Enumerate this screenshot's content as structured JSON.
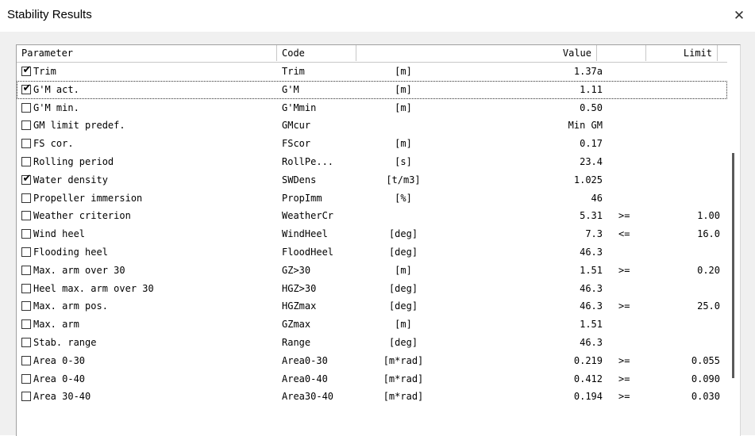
{
  "window": {
    "title": "Stability Results",
    "close_glyph": "✕"
  },
  "table": {
    "headers": {
      "parameter": "Parameter",
      "code": "Code",
      "unit": "",
      "value": "Value",
      "op": "",
      "limit": "Limit"
    },
    "rows": [
      {
        "checked": true,
        "parameter": "Trim",
        "code": "Trim",
        "unit": "[m]",
        "value": "1.37a",
        "op": "",
        "limit": ""
      },
      {
        "checked": true,
        "parameter": "G'M act.",
        "code": "G'M",
        "unit": "[m]",
        "value": "1.11",
        "op": "",
        "limit": ""
      },
      {
        "checked": false,
        "parameter": "G'M min.",
        "code": "G'Mmin",
        "unit": "[m]",
        "value": "0.50",
        "op": "",
        "limit": ""
      },
      {
        "checked": false,
        "parameter": "GM limit predef.",
        "code": "GMcur",
        "unit": "",
        "value": "Min GM",
        "op": "",
        "limit": ""
      },
      {
        "checked": false,
        "parameter": "FS cor.",
        "code": "FScor",
        "unit": "[m]",
        "value": "0.17",
        "op": "",
        "limit": ""
      },
      {
        "checked": false,
        "parameter": "Rolling period",
        "code": "RollPe...",
        "unit": "[s]",
        "value": "23.4",
        "op": "",
        "limit": ""
      },
      {
        "checked": true,
        "parameter": "Water density",
        "code": "SWDens",
        "unit": "[t/m3]",
        "value": "1.025",
        "op": "",
        "limit": ""
      },
      {
        "checked": false,
        "parameter": "Propeller immersion",
        "code": "PropImm",
        "unit": "[%]",
        "value": "46",
        "op": "",
        "limit": ""
      },
      {
        "checked": false,
        "parameter": "Weather criterion",
        "code": "WeatherCr",
        "unit": "",
        "value": "5.31",
        "op": ">=",
        "limit": "1.00"
      },
      {
        "checked": false,
        "parameter": "Wind heel",
        "code": "WindHeel",
        "unit": "[deg]",
        "value": "7.3",
        "op": "<=",
        "limit": "16.0"
      },
      {
        "checked": false,
        "parameter": "Flooding heel",
        "code": "FloodHeel",
        "unit": "[deg]",
        "value": "46.3",
        "op": "",
        "limit": ""
      },
      {
        "checked": false,
        "parameter": "Max. arm over 30",
        "code": "GZ>30",
        "unit": "[m]",
        "value": "1.51",
        "op": ">=",
        "limit": "0.20"
      },
      {
        "checked": false,
        "parameter": "Heel max. arm over 30",
        "code": "HGZ>30",
        "unit": "[deg]",
        "value": "46.3",
        "op": "",
        "limit": ""
      },
      {
        "checked": false,
        "parameter": "Max. arm pos.",
        "code": "HGZmax",
        "unit": "[deg]",
        "value": "46.3",
        "op": ">=",
        "limit": "25.0"
      },
      {
        "checked": false,
        "parameter": "Max. arm",
        "code": "GZmax",
        "unit": "[m]",
        "value": "1.51",
        "op": "",
        "limit": ""
      },
      {
        "checked": false,
        "parameter": "Stab. range",
        "code": "Range",
        "unit": "[deg]",
        "value": "46.3",
        "op": "",
        "limit": ""
      },
      {
        "checked": false,
        "parameter": "Area  0-30",
        "code": "Area0-30",
        "unit": "[m*rad]",
        "value": "0.219",
        "op": ">=",
        "limit": "0.055"
      },
      {
        "checked": false,
        "parameter": "Area  0-40",
        "code": "Area0-40",
        "unit": "[m*rad]",
        "value": "0.412",
        "op": ">=",
        "limit": "0.090"
      },
      {
        "checked": false,
        "parameter": "Area 30-40",
        "code": "Area30-40",
        "unit": "[m*rad]",
        "value": "0.194",
        "op": ">=",
        "limit": "0.030"
      }
    ]
  }
}
